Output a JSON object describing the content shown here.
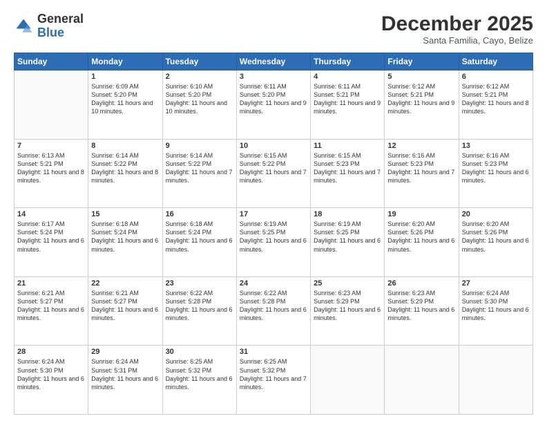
{
  "header": {
    "logo_general": "General",
    "logo_blue": "Blue",
    "month_title": "December 2025",
    "subtitle": "Santa Familia, Cayo, Belize"
  },
  "days_of_week": [
    "Sunday",
    "Monday",
    "Tuesday",
    "Wednesday",
    "Thursday",
    "Friday",
    "Saturday"
  ],
  "weeks": [
    [
      {
        "day": "",
        "sunrise": "",
        "sunset": "",
        "daylight": ""
      },
      {
        "day": "1",
        "sunrise": "Sunrise: 6:09 AM",
        "sunset": "Sunset: 5:20 PM",
        "daylight": "Daylight: 11 hours and 10 minutes."
      },
      {
        "day": "2",
        "sunrise": "Sunrise: 6:10 AM",
        "sunset": "Sunset: 5:20 PM",
        "daylight": "Daylight: 11 hours and 10 minutes."
      },
      {
        "day": "3",
        "sunrise": "Sunrise: 6:11 AM",
        "sunset": "Sunset: 5:20 PM",
        "daylight": "Daylight: 11 hours and 9 minutes."
      },
      {
        "day": "4",
        "sunrise": "Sunrise: 6:11 AM",
        "sunset": "Sunset: 5:21 PM",
        "daylight": "Daylight: 11 hours and 9 minutes."
      },
      {
        "day": "5",
        "sunrise": "Sunrise: 6:12 AM",
        "sunset": "Sunset: 5:21 PM",
        "daylight": "Daylight: 11 hours and 9 minutes."
      },
      {
        "day": "6",
        "sunrise": "Sunrise: 6:12 AM",
        "sunset": "Sunset: 5:21 PM",
        "daylight": "Daylight: 11 hours and 8 minutes."
      }
    ],
    [
      {
        "day": "7",
        "sunrise": "Sunrise: 6:13 AM",
        "sunset": "Sunset: 5:21 PM",
        "daylight": "Daylight: 11 hours and 8 minutes."
      },
      {
        "day": "8",
        "sunrise": "Sunrise: 6:14 AM",
        "sunset": "Sunset: 5:22 PM",
        "daylight": "Daylight: 11 hours and 8 minutes."
      },
      {
        "day": "9",
        "sunrise": "Sunrise: 6:14 AM",
        "sunset": "Sunset: 5:22 PM",
        "daylight": "Daylight: 11 hours and 7 minutes."
      },
      {
        "day": "10",
        "sunrise": "Sunrise: 6:15 AM",
        "sunset": "Sunset: 5:22 PM",
        "daylight": "Daylight: 11 hours and 7 minutes."
      },
      {
        "day": "11",
        "sunrise": "Sunrise: 6:15 AM",
        "sunset": "Sunset: 5:23 PM",
        "daylight": "Daylight: 11 hours and 7 minutes."
      },
      {
        "day": "12",
        "sunrise": "Sunrise: 6:16 AM",
        "sunset": "Sunset: 5:23 PM",
        "daylight": "Daylight: 11 hours and 7 minutes."
      },
      {
        "day": "13",
        "sunrise": "Sunrise: 6:16 AM",
        "sunset": "Sunset: 5:23 PM",
        "daylight": "Daylight: 11 hours and 6 minutes."
      }
    ],
    [
      {
        "day": "14",
        "sunrise": "Sunrise: 6:17 AM",
        "sunset": "Sunset: 5:24 PM",
        "daylight": "Daylight: 11 hours and 6 minutes."
      },
      {
        "day": "15",
        "sunrise": "Sunrise: 6:18 AM",
        "sunset": "Sunset: 5:24 PM",
        "daylight": "Daylight: 11 hours and 6 minutes."
      },
      {
        "day": "16",
        "sunrise": "Sunrise: 6:18 AM",
        "sunset": "Sunset: 5:24 PM",
        "daylight": "Daylight: 11 hours and 6 minutes."
      },
      {
        "day": "17",
        "sunrise": "Sunrise: 6:19 AM",
        "sunset": "Sunset: 5:25 PM",
        "daylight": "Daylight: 11 hours and 6 minutes."
      },
      {
        "day": "18",
        "sunrise": "Sunrise: 6:19 AM",
        "sunset": "Sunset: 5:25 PM",
        "daylight": "Daylight: 11 hours and 6 minutes."
      },
      {
        "day": "19",
        "sunrise": "Sunrise: 6:20 AM",
        "sunset": "Sunset: 5:26 PM",
        "daylight": "Daylight: 11 hours and 6 minutes."
      },
      {
        "day": "20",
        "sunrise": "Sunrise: 6:20 AM",
        "sunset": "Sunset: 5:26 PM",
        "daylight": "Daylight: 11 hours and 6 minutes."
      }
    ],
    [
      {
        "day": "21",
        "sunrise": "Sunrise: 6:21 AM",
        "sunset": "Sunset: 5:27 PM",
        "daylight": "Daylight: 11 hours and 6 minutes."
      },
      {
        "day": "22",
        "sunrise": "Sunrise: 6:21 AM",
        "sunset": "Sunset: 5:27 PM",
        "daylight": "Daylight: 11 hours and 6 minutes."
      },
      {
        "day": "23",
        "sunrise": "Sunrise: 6:22 AM",
        "sunset": "Sunset: 5:28 PM",
        "daylight": "Daylight: 11 hours and 6 minutes."
      },
      {
        "day": "24",
        "sunrise": "Sunrise: 6:22 AM",
        "sunset": "Sunset: 5:28 PM",
        "daylight": "Daylight: 11 hours and 6 minutes."
      },
      {
        "day": "25",
        "sunrise": "Sunrise: 6:23 AM",
        "sunset": "Sunset: 5:29 PM",
        "daylight": "Daylight: 11 hours and 6 minutes."
      },
      {
        "day": "26",
        "sunrise": "Sunrise: 6:23 AM",
        "sunset": "Sunset: 5:29 PM",
        "daylight": "Daylight: 11 hours and 6 minutes."
      },
      {
        "day": "27",
        "sunrise": "Sunrise: 6:24 AM",
        "sunset": "Sunset: 5:30 PM",
        "daylight": "Daylight: 11 hours and 6 minutes."
      }
    ],
    [
      {
        "day": "28",
        "sunrise": "Sunrise: 6:24 AM",
        "sunset": "Sunset: 5:30 PM",
        "daylight": "Daylight: 11 hours and 6 minutes."
      },
      {
        "day": "29",
        "sunrise": "Sunrise: 6:24 AM",
        "sunset": "Sunset: 5:31 PM",
        "daylight": "Daylight: 11 hours and 6 minutes."
      },
      {
        "day": "30",
        "sunrise": "Sunrise: 6:25 AM",
        "sunset": "Sunset: 5:32 PM",
        "daylight": "Daylight: 11 hours and 6 minutes."
      },
      {
        "day": "31",
        "sunrise": "Sunrise: 6:25 AM",
        "sunset": "Sunset: 5:32 PM",
        "daylight": "Daylight: 11 hours and 7 minutes."
      },
      {
        "day": "",
        "sunrise": "",
        "sunset": "",
        "daylight": ""
      },
      {
        "day": "",
        "sunrise": "",
        "sunset": "",
        "daylight": ""
      },
      {
        "day": "",
        "sunrise": "",
        "sunset": "",
        "daylight": ""
      }
    ]
  ]
}
